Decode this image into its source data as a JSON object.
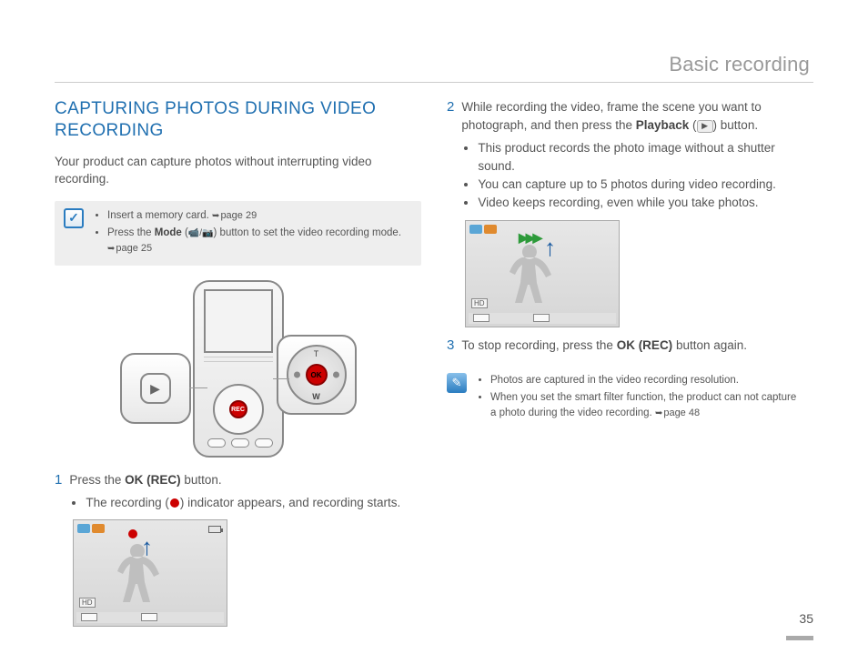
{
  "header": {
    "title": "Basic recording"
  },
  "page_number": "35",
  "left": {
    "heading": "CAPTURING PHOTOS DURING VIDEO RECORDING",
    "intro": "Your product can capture photos without interrupting video recording.",
    "prereq": {
      "item1_a": "Insert a memory card. ",
      "item1_ref": "page 29",
      "item2_a": "Press the ",
      "item2_bold": "Mode",
      "item2_b": " (",
      "item2_c": ") button to set the video recording mode. ",
      "item2_ref": "page 25"
    },
    "device": {
      "ok_label": "OK",
      "wheel_t": "T",
      "wheel_w": "W",
      "rec_label": "REC"
    },
    "step1": {
      "num": "1",
      "line_a": "Press the ",
      "line_bold": "OK (REC)",
      "line_b": " button.",
      "bullet_a": "The recording (",
      "bullet_b": ") indicator appears, and recording starts."
    },
    "screen1": {
      "hd": "HD"
    }
  },
  "right": {
    "step2": {
      "num": "2",
      "line_a": "While recording the video, frame the scene you want to photograph, and then press the ",
      "line_bold": "Playback",
      "line_b": " (",
      "line_c": ") button.",
      "bullets": [
        "This product records the photo image without a shutter sound.",
        "You can capture up to 5 photos during video recording.",
        "Video keeps recording, even while you take photos."
      ]
    },
    "screen2": {
      "hd": "HD"
    },
    "step3": {
      "num": "3",
      "line_a": "To stop recording, press the ",
      "line_bold": "OK (REC)",
      "line_b": " button again."
    },
    "note": {
      "b1": "Photos are captured in the video recording resolution.",
      "b2_a": "When you set the smart filter function, the product can not capture a photo during the video recording. ",
      "b2_ref": "page 48"
    }
  }
}
